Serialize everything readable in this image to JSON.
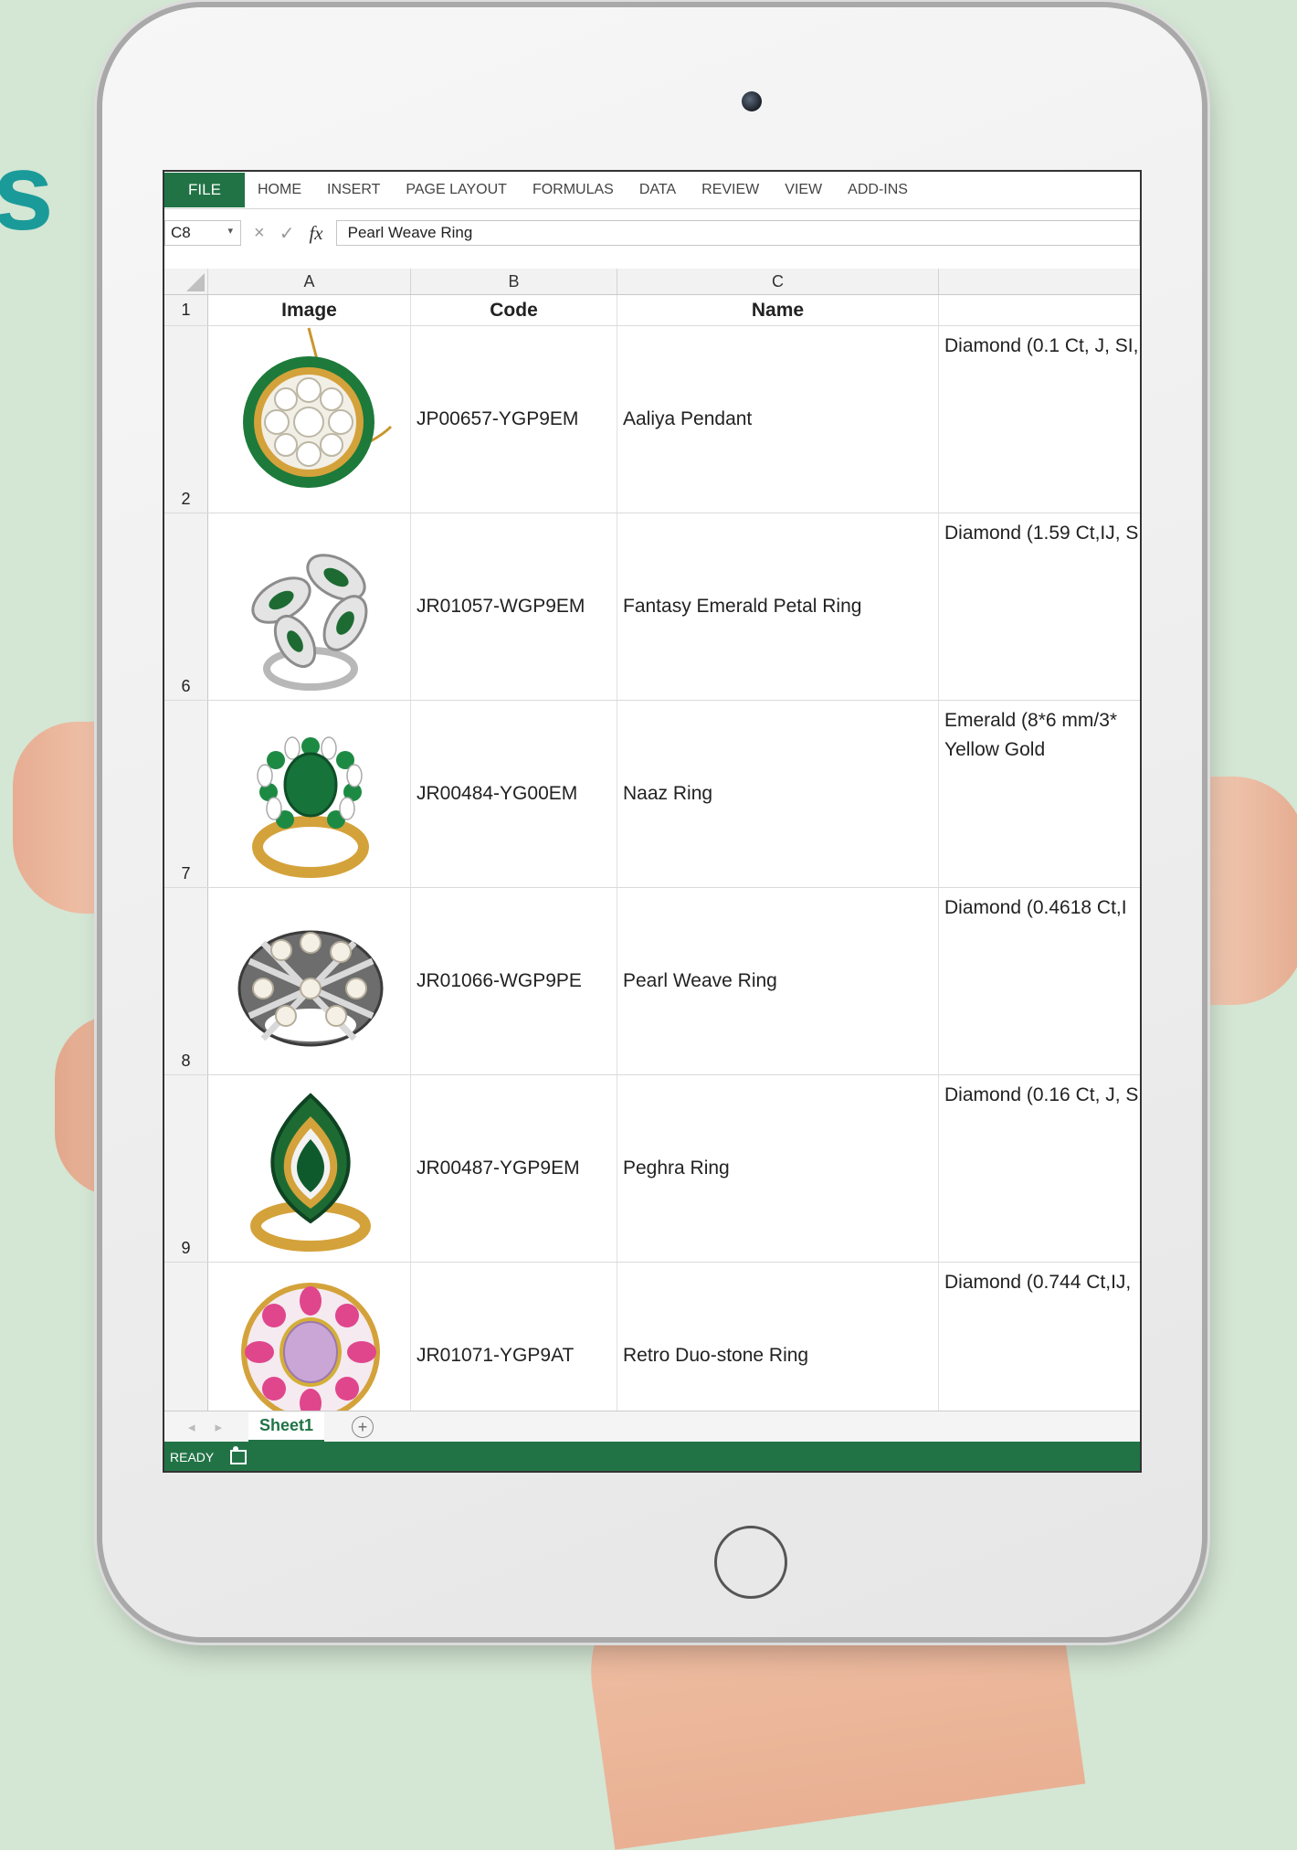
{
  "background_text": "s",
  "ribbon": {
    "file_tab": "FILE",
    "tabs": [
      "HOME",
      "INSERT",
      "PAGE LAYOUT",
      "FORMULAS",
      "DATA",
      "REVIEW",
      "VIEW",
      "ADD-INS"
    ]
  },
  "formula_bar": {
    "name_box": "C8",
    "cancel_symbol": "×",
    "enter_symbol": "✓",
    "fx_label": "fx",
    "value": "Pearl Weave Ring"
  },
  "columns": [
    "A",
    "B",
    "C",
    ""
  ],
  "header_row": {
    "num": "1",
    "image": "Image",
    "code": "Code",
    "name": "Name"
  },
  "rows": [
    {
      "num": "2",
      "code": "JP00657-YGP9EM",
      "name": "Aaliya Pendant",
      "desc": "Diamond (0.1 Ct, J, SI,"
    },
    {
      "num": "6",
      "code": "JR01057-WGP9EM",
      "name": "Fantasy Emerald Petal Ring",
      "desc": "Diamond (1.59 Ct,IJ, S"
    },
    {
      "num": "7",
      "code": "JR00484-YG00EM",
      "name": "Naaz Ring",
      "desc": "Emerald (8*6 mm/3*\nYellow Gold"
    },
    {
      "num": "8",
      "code": "JR01066-WGP9PE",
      "name": "Pearl Weave Ring",
      "desc": "Diamond (0.4618 Ct,I"
    },
    {
      "num": "9",
      "code": "JR00487-YGP9EM",
      "name": "Peghra Ring",
      "desc": "Diamond (0.16 Ct, J, S"
    },
    {
      "num": "",
      "code": "JR01071-YGP9AT",
      "name": "Retro Duo-stone Ring",
      "desc": "Diamond (0.744 Ct,IJ,"
    }
  ],
  "sheet_tabs": {
    "active": "Sheet1",
    "add": "+"
  },
  "status": {
    "label": "READY"
  },
  "colors": {
    "excel_green": "#217346",
    "emerald": "#1d7a3a",
    "gold": "#d4a23a",
    "pink": "#e0468c",
    "amethyst": "#c9a6d6"
  },
  "icons": [
    "add-sheet-icon",
    "macro-record-icon",
    "camera-icon",
    "home-button-icon"
  ]
}
